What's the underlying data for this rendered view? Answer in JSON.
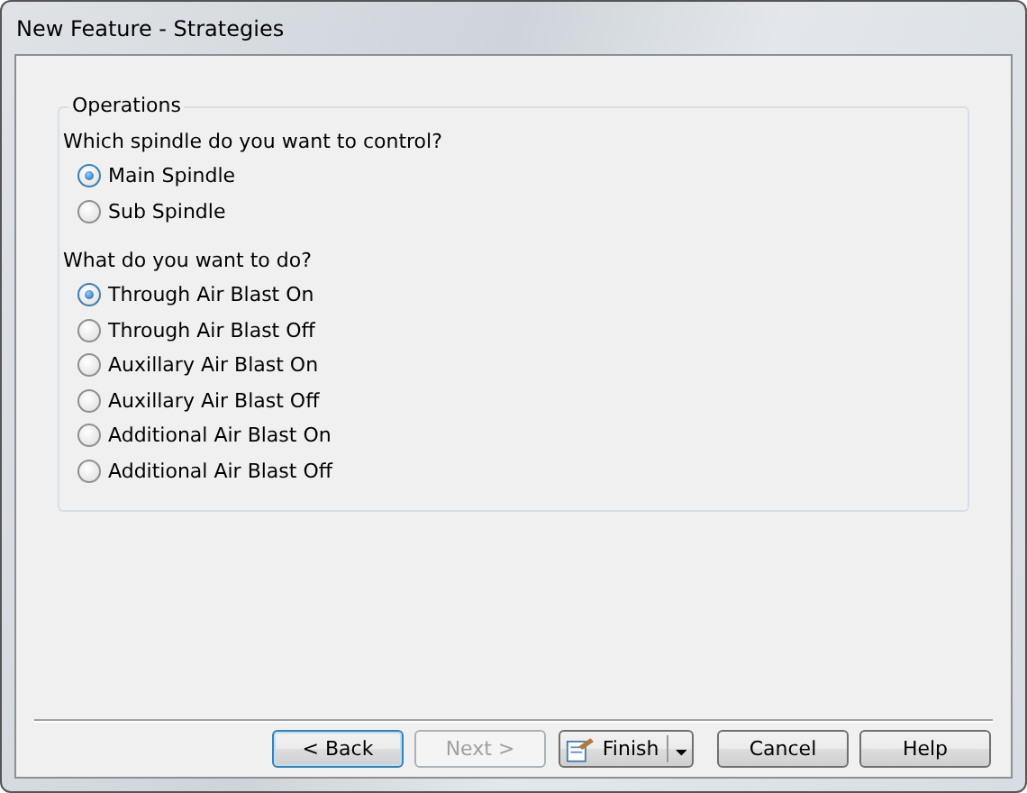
{
  "window": {
    "title": "New Feature - Strategies"
  },
  "group": {
    "title": "Operations",
    "sections": [
      {
        "question": "Which spindle do you want to control?",
        "options": [
          {
            "label": "Main Spindle",
            "selected": true
          },
          {
            "label": "Sub Spindle",
            "selected": false
          }
        ]
      },
      {
        "question": "What do you want to do?",
        "options": [
          {
            "label": "Through Air Blast On",
            "selected": true
          },
          {
            "label": "Through Air Blast Off",
            "selected": false
          },
          {
            "label": "Auxillary Air Blast On",
            "selected": false
          },
          {
            "label": "Auxillary Air Blast Off",
            "selected": false
          },
          {
            "label": "Additional Air Blast On",
            "selected": false
          },
          {
            "label": "Additional Air Blast Off",
            "selected": false
          }
        ]
      }
    ]
  },
  "buttons": [
    {
      "label": "< Back",
      "kind": "default",
      "disabled": false
    },
    {
      "label": "Next >",
      "kind": "plain",
      "disabled": true
    },
    {
      "label": "Finish",
      "kind": "split",
      "disabled": false
    },
    {
      "label": "Cancel",
      "kind": "plain",
      "disabled": false
    },
    {
      "label": "Help",
      "kind": "plain",
      "disabled": false
    }
  ]
}
